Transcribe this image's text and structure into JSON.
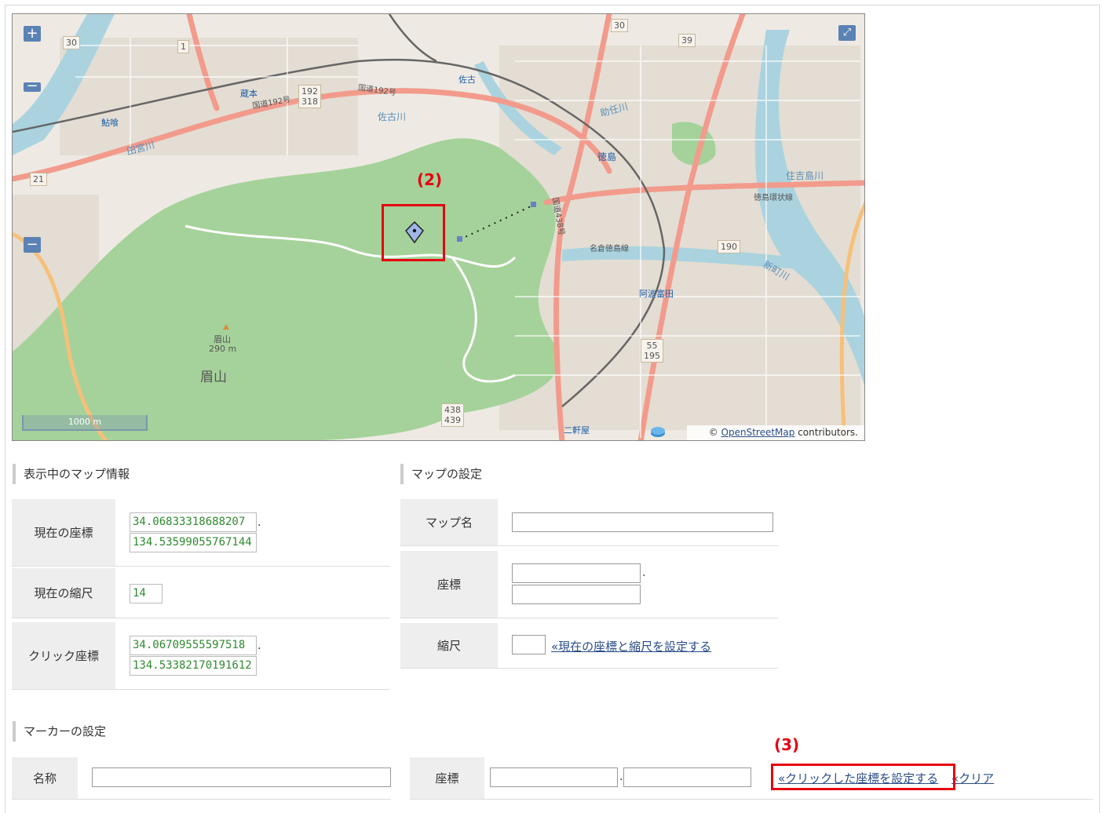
{
  "map": {
    "zoom_in": "+",
    "zoom_out": "−",
    "zoom_out_left": "−",
    "scale_label": "1000 m",
    "attribution_prefix": "©",
    "attribution_link": "OpenStreetMap",
    "attribution_suffix": "contributors.",
    "labels": {
      "bizan": "眉山",
      "bizan_peak": "眉山",
      "bizan_elev": "290 m",
      "tokushima": "徳島",
      "kuramoto": "蔵本",
      "sako": "佐古",
      "ayu": "鮎喰",
      "awatomida": "阿波富田",
      "nikenya": "二軒屋",
      "kokudo192": "国道192号",
      "kokudo192b": "国道192号",
      "sakogawa": "佐古川",
      "tamiyagawa": "田宮川",
      "sukegawa": "助任川",
      "sumiyoshi": "住吉島川",
      "tokushima_loop": "徳島環状線",
      "shinmachi": "新町川",
      "meikei": "名倉徳島線",
      "route438": "国道438号"
    },
    "shields": [
      "30",
      "1",
      "192\n318",
      "30",
      "39",
      "21",
      "190",
      "55\n195",
      "438\n439"
    ]
  },
  "annotations": {
    "a2": "(2)",
    "a3": "(3)"
  },
  "map_info": {
    "heading": "表示中のマップ情報",
    "current_coord_label": "現在の座標",
    "current_lat": "34.06833318688207",
    "current_lng": "134.53599055767144",
    "current_zoom_label": "現在の縮尺",
    "current_zoom": "14",
    "click_coord_label": "クリック座標",
    "click_lat": "34.06709555597518",
    "click_lng": "134.53382170191612",
    "sep": "."
  },
  "map_settings": {
    "heading": "マップの設定",
    "name_label": "マップ名",
    "coord_label": "座標",
    "zoom_label": "縮尺",
    "set_current_link": "«現在の座標と縮尺を設定する",
    "sep": "."
  },
  "marker_settings": {
    "heading": "マーカーの設定",
    "name_label": "名称",
    "coord_label": "座標",
    "set_click_link": "«クリックした座標を設定する",
    "clear_link": "«クリア",
    "sep": "."
  },
  "colors": {
    "highlight": "#e60012",
    "park": "#a5d29a",
    "road": "#f29b8c",
    "water": "#aad3df",
    "link": "#2a4d89",
    "value_text": "#2f8a2f"
  }
}
